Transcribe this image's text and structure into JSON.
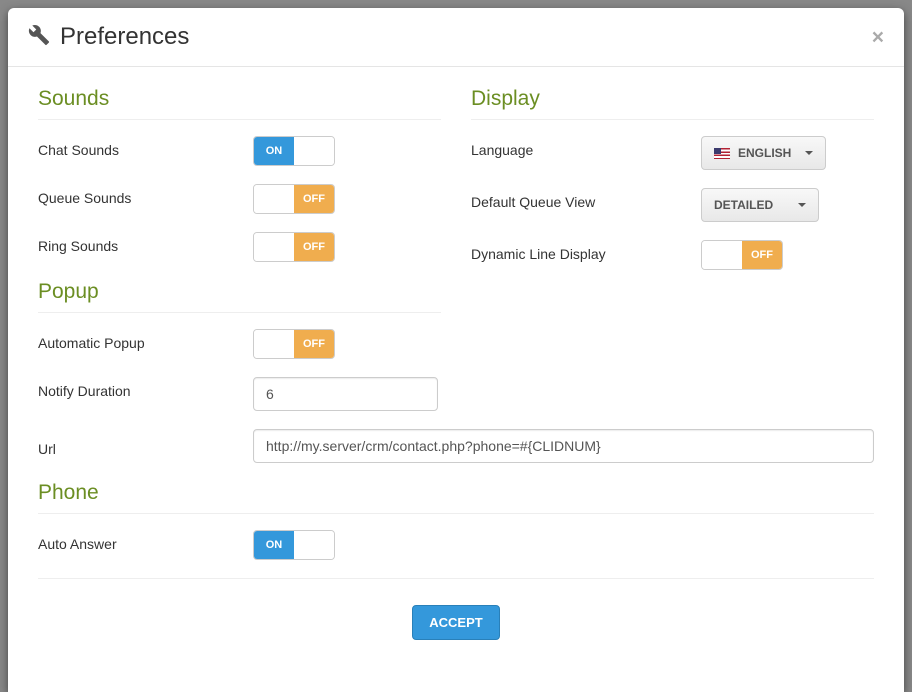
{
  "header": {
    "title": "Preferences"
  },
  "sections": {
    "sounds": {
      "title": "Sounds",
      "chat_label": "Chat Sounds",
      "chat_state": "on",
      "chat_text": "ON",
      "queue_label": "Queue Sounds",
      "queue_state": "off",
      "queue_text": "OFF",
      "ring_label": "Ring Sounds",
      "ring_state": "off",
      "ring_text": "OFF"
    },
    "popup": {
      "title": "Popup",
      "auto_label": "Automatic Popup",
      "auto_state": "off",
      "auto_text": "OFF",
      "notify_label": "Notify Duration",
      "notify_value": "6",
      "url_label": "Url",
      "url_value": "http://my.server/crm/contact.php?phone=#{CLIDNUM}"
    },
    "phone": {
      "title": "Phone",
      "auto_answer_label": "Auto Answer",
      "auto_answer_state": "on",
      "auto_answer_text": "ON"
    },
    "display": {
      "title": "Display",
      "language_label": "Language",
      "language_value": "ENGLISH",
      "queue_view_label": "Default Queue View",
      "queue_view_value": "DETAILED",
      "dynamic_label": "Dynamic Line Display",
      "dynamic_state": "off",
      "dynamic_text": "OFF"
    }
  },
  "footer": {
    "accept": "ACCEPT"
  }
}
